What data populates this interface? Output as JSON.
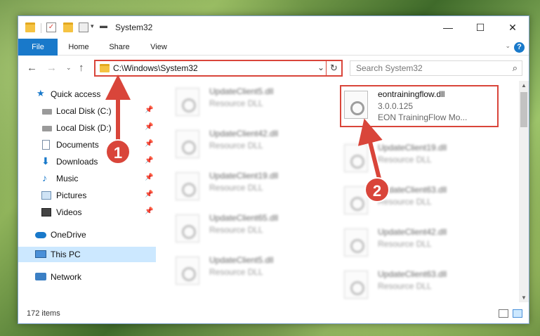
{
  "window": {
    "title": "System32",
    "controls": {
      "minimize": "—",
      "maximize": "☐",
      "close": "✕"
    }
  },
  "ribbon": {
    "tabs": [
      "File",
      "Home",
      "Share",
      "View"
    ],
    "help": "?"
  },
  "address": {
    "path": "C:\\Windows\\System32",
    "search_placeholder": "Search System32"
  },
  "nav": {
    "items": [
      {
        "label": "Quick access",
        "icon": "star-icon",
        "pinned": false
      },
      {
        "label": "Local Disk (C:)",
        "icon": "drive-icon",
        "pinned": true
      },
      {
        "label": "Local Disk (D:)",
        "icon": "drive-icon",
        "pinned": true
      },
      {
        "label": "Documents",
        "icon": "documents-icon",
        "pinned": true
      },
      {
        "label": "Downloads",
        "icon": "download-icon",
        "pinned": true
      },
      {
        "label": "Music",
        "icon": "music-icon",
        "pinned": true
      },
      {
        "label": "Pictures",
        "icon": "pictures-icon",
        "pinned": true
      },
      {
        "label": "Videos",
        "icon": "videos-icon",
        "pinned": true
      },
      {
        "label": "OneDrive",
        "icon": "cloud-icon",
        "pinned": false
      },
      {
        "label": "This PC",
        "icon": "computer-icon",
        "pinned": false
      },
      {
        "label": "Network",
        "icon": "network-icon",
        "pinned": false
      }
    ]
  },
  "files": {
    "left_column": [
      {
        "name": "UpdateClient5.dll",
        "type": "Resource DLL"
      },
      {
        "name": "UpdateClient42.dll",
        "type": "Resource DLL"
      },
      {
        "name": "UpdateClient19.dll",
        "type": "Resource DLL"
      },
      {
        "name": "UpdateClient65.dll",
        "type": "Resource DLL"
      },
      {
        "name": "UpdateClient5.dll",
        "type": "Resource DLL"
      }
    ],
    "highlighted": {
      "name": "eontrainingflow.dll",
      "version": "3.0.0.125",
      "description": "EON TrainingFlow Mo..."
    },
    "right_column": [
      {
        "name": "UpdateClient19.dll",
        "type": "Resource DLL"
      },
      {
        "name": "UpdateClient63.dll",
        "type": "Resource DLL"
      },
      {
        "name": "UpdateClient42.dll",
        "type": "Resource DLL"
      },
      {
        "name": "UpdateClient63.dll",
        "type": "Resource DLL"
      }
    ]
  },
  "status": {
    "item_count": "172 items"
  },
  "callouts": {
    "step1": "1",
    "step2": "2",
    "color": "#d9453a"
  }
}
